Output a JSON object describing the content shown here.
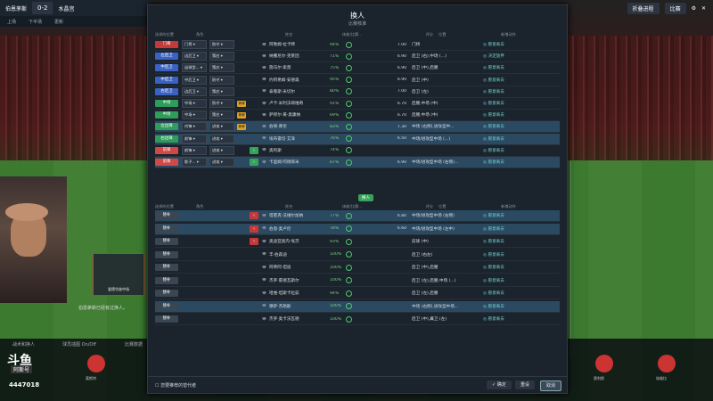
{
  "scoreboard": {
    "home": "伯恩茅斯",
    "score": "0-2",
    "away": "水晶宫",
    "time_label": "上场",
    "mode": "下半场",
    "extra": "更新"
  },
  "topright": {
    "btn1": "折叠进程",
    "btn2": "比赛"
  },
  "bottom": {
    "tactics_label": "战术和换人",
    "feedback_label": "球员插图 On/Off",
    "stats_label": "比赛数据",
    "brand": "斗鱼",
    "brand_sub": "阿斯号",
    "room_id": "4447018",
    "player1": "莫斯特",
    "player2": "奥利斯",
    "player3": "埃维拉"
  },
  "overlay": {
    "card_name": "爱德华兹中场",
    "chat": "伯恩茅斯已经有过换人。"
  },
  "modal": {
    "title": "换人",
    "subtitle": "比赛核准",
    "headers": {
      "pos": "选择的位置",
      "role": "角色",
      "duty": "",
      "name": "姓名",
      "cond": "体能/比赛...",
      "rating": "评分",
      "position": "位置",
      "action": "新增动作"
    },
    "starters": [
      {
        "pos": "门将",
        "cls": "gk",
        "role": "门将",
        "duty": "防守",
        "badge": "",
        "arrow": "",
        "name": "阿勒姆·拉卡特",
        "cond": "94%",
        "rating": "7.00",
        "position": "门将",
        "action": "愿意离去",
        "hl": false
      },
      {
        "pos": "左后卫",
        "cls": "def",
        "role": "边后卫",
        "duty": "策应",
        "badge": "",
        "arrow": "",
        "name": "纳撒尼尔·克莱因",
        "cond": "71%",
        "rating": "6.90",
        "position": "后卫 (右),中场 (...)",
        "action": "决定放弃",
        "hl": false
      },
      {
        "pos": "中后卫",
        "cls": "def",
        "role": "出球型...",
        "duty": "策应",
        "badge": "",
        "arrow": "",
        "name": "施马尔·索莫",
        "cond": "75%",
        "rating": "6.90",
        "position": "后卫 (中),后腰",
        "action": "愿意离去",
        "hl": false
      },
      {
        "pos": "中后卫",
        "cls": "def",
        "role": "中后卫",
        "duty": "防守",
        "badge": "",
        "arrow": "",
        "name": "约阿希姆·安德森",
        "cond": "95%",
        "rating": "6.90",
        "position": "后卫 (中)",
        "action": "愿意离去",
        "hl": false
      },
      {
        "pos": "右后卫",
        "cls": "def",
        "role": "边后卫",
        "duty": "策应",
        "badge": "",
        "arrow": "",
        "name": "泰隆斯·米切尔",
        "cond": "80%",
        "rating": "7.00",
        "position": "后卫 (左)",
        "action": "愿意离去",
        "hl": false
      },
      {
        "pos": "中场",
        "cls": "mid",
        "role": "中场",
        "duty": "防守",
        "badge": "黄牌",
        "arrow": "",
        "name": "卢卡·米利沃耶维奇",
        "cond": "91%",
        "rating": "6.70",
        "position": "后腰,中场 (中)",
        "action": "愿意离去",
        "hl": false
      },
      {
        "pos": "中场",
        "cls": "mid",
        "role": "中场",
        "duty": "策应",
        "badge": "黄牌",
        "arrow": "",
        "name": "萨缪尔·黄·奥康纳",
        "cond": "69%",
        "rating": "6.70",
        "position": "后腰,中场 (中)",
        "action": "愿意离去",
        "hl": false
      },
      {
        "pos": "左边锋",
        "cls": "mid",
        "role": "内锋",
        "duty": "进攻",
        "badge": "黄牌",
        "arrow": "",
        "name": "伯顿·库伦",
        "cond": "83%",
        "rating": "7.30",
        "position": "中场 (右侧),进攻型中...",
        "action": "愿意离去",
        "hl": true
      },
      {
        "pos": "右边锋",
        "cls": "mid",
        "role": "前锋",
        "duty": "进攻",
        "badge": "",
        "arrow": "",
        "name": "埃布雷切·艾泽",
        "cond": "76%",
        "rating": "6.50",
        "position": "中场/进攻型中场 (...)",
        "action": "愿意离去",
        "hl": true
      },
      {
        "pos": "前锋",
        "cls": "att",
        "role": "前锋",
        "duty": "进攻",
        "badge": "",
        "arrow": "›",
        "name": "奥利斯",
        "cond": "74%",
        "rating": "",
        "position": "",
        "action": "愿意离去",
        "hl": false
      },
      {
        "pos": "前锋",
        "cls": "att",
        "role": "影子...",
        "duty": "进攻",
        "badge": "",
        "arrow": "›",
        "name": "卡里姆·阿德耶米",
        "cond": "87%",
        "rating": "6.90",
        "position": "中场/进攻型中场 (右侧)...",
        "action": "愿意离去",
        "hl": true
      }
    ],
    "sub_chip": "换人",
    "sub_header": {
      "pos": "选择的位置",
      "role": "角色",
      "name": "姓名",
      "cond": "体能/比赛...",
      "rating": "评分",
      "position": "位置",
      "action": "新增动作"
    },
    "subs": [
      {
        "pos": "替补",
        "arrow": "‹",
        "name": "塔雷克·法维尔加纳",
        "cond": "77%",
        "rating": "6.80",
        "position": "中场/进攻型中场 (右侧)",
        "action": "愿意离去",
        "hl": true
      },
      {
        "pos": "替补",
        "arrow": "‹",
        "name": "伯恩·奥卢伦",
        "cond": "78%",
        "rating": "6.60",
        "position": "中场/进攻型中场 (左中)",
        "action": "愿意离去",
        "hl": true
      },
      {
        "pos": "替补",
        "arrow": "‹",
        "name": "奥迪亚奥内·埃茨",
        "cond": "93%",
        "rating": "",
        "position": "前锋 (中)",
        "action": "愿意离去",
        "hl": false
      },
      {
        "pos": "替补",
        "arrow": "",
        "name": "丰·伯森迪",
        "cond": "100%",
        "rating": "",
        "position": "后卫 (右左)",
        "action": "愿意离去",
        "hl": false
      },
      {
        "pos": "替补",
        "arrow": "",
        "name": "阿蒂阿·坦迪",
        "cond": "100%",
        "rating": "",
        "position": "后卫 (中),后腰",
        "action": "愿意离去",
        "hl": false
      },
      {
        "pos": "替补",
        "arrow": "",
        "name": "杰罗·雷德瓦斯尔",
        "cond": "100%",
        "rating": "",
        "position": "后卫 (左),后腰,中场 (...)",
        "action": "愿意离去",
        "hl": false
      },
      {
        "pos": "替补",
        "arrow": "",
        "name": "哈维·坦斯卡拉兹",
        "cond": "94%",
        "rating": "",
        "position": "后卫 (左),后腰",
        "action": "愿意离去",
        "hl": false
      },
      {
        "pos": "替补",
        "arrow": "",
        "name": "穆萨·杰勒斯",
        "cond": "100%",
        "rating": "",
        "position": "中场 (右侧),进攻型中场...",
        "action": "愿意离去",
        "hl": true
      },
      {
        "pos": "替补",
        "arrow": "",
        "name": "杰罗·奥卡沃瓦德",
        "cond": "100%",
        "rating": "",
        "position": "后卫 (中),冀卫 (左)",
        "action": "愿意离去",
        "hl": false
      }
    ],
    "footer": {
      "suggest": "您要推荐的替代者",
      "confirm": "确定",
      "reset": "重设",
      "cancel": "取消"
    }
  }
}
